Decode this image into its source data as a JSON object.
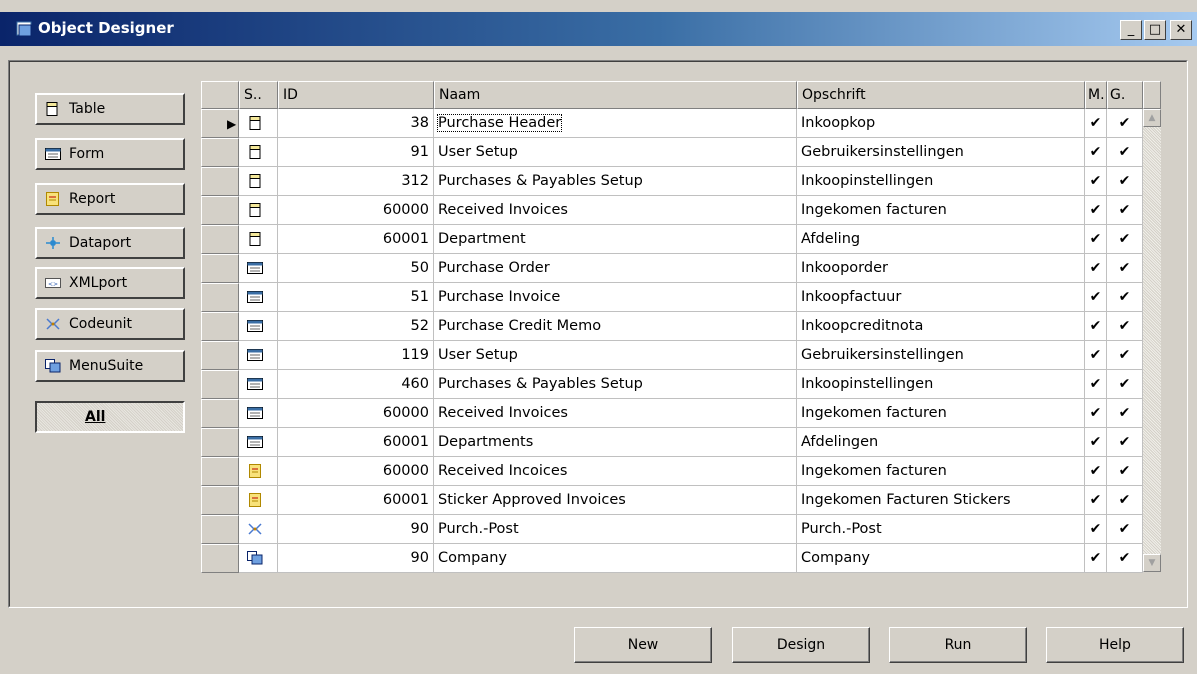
{
  "window": {
    "title": "Object Designer",
    "min_label": "_",
    "max_label": "□",
    "close_label": "✕"
  },
  "sidebar": {
    "items": [
      {
        "label": "Table",
        "icon": "table-icon"
      },
      {
        "label": "Form",
        "icon": "form-icon"
      },
      {
        "label": "Report",
        "icon": "report-icon"
      },
      {
        "label": "Dataport",
        "icon": "dataport-icon"
      },
      {
        "label": "XMLport",
        "icon": "xmlport-icon"
      },
      {
        "label": "Codeunit",
        "icon": "codeunit-icon"
      },
      {
        "label": "MenuSuite",
        "icon": "menusuite-icon"
      },
      {
        "label": "All",
        "icon": ""
      }
    ]
  },
  "grid": {
    "headers": [
      "S..",
      "ID",
      "Naam",
      "Opschrift",
      "M.",
      "G."
    ],
    "rows": [
      {
        "type": "table",
        "id": "38",
        "name": "Purchase Header",
        "caption": "Inkoopkop",
        "m": "✔",
        "g": "✔"
      },
      {
        "type": "table",
        "id": "91",
        "name": "User Setup",
        "caption": "Gebruikersinstellingen",
        "m": "✔",
        "g": "✔"
      },
      {
        "type": "table",
        "id": "312",
        "name": "Purchases & Payables Setup",
        "caption": "Inkoopinstellingen",
        "m": "✔",
        "g": "✔"
      },
      {
        "type": "table",
        "id": "60000",
        "name": "Received Invoices",
        "caption": "Ingekomen facturen",
        "m": "✔",
        "g": "✔"
      },
      {
        "type": "table",
        "id": "60001",
        "name": "Department",
        "caption": "Afdeling",
        "m": "✔",
        "g": "✔"
      },
      {
        "type": "form",
        "id": "50",
        "name": "Purchase Order",
        "caption": "Inkooporder",
        "m": "✔",
        "g": "✔"
      },
      {
        "type": "form",
        "id": "51",
        "name": "Purchase Invoice",
        "caption": "Inkoopfactuur",
        "m": "✔",
        "g": "✔"
      },
      {
        "type": "form",
        "id": "52",
        "name": "Purchase Credit Memo",
        "caption": "Inkoopcreditnota",
        "m": "✔",
        "g": "✔"
      },
      {
        "type": "form",
        "id": "119",
        "name": "User Setup",
        "caption": "Gebruikersinstellingen",
        "m": "✔",
        "g": "✔"
      },
      {
        "type": "form",
        "id": "460",
        "name": "Purchases & Payables Setup",
        "caption": "Inkoopinstellingen",
        "m": "✔",
        "g": "✔"
      },
      {
        "type": "form",
        "id": "60000",
        "name": "Received Invoices",
        "caption": "Ingekomen facturen",
        "m": "✔",
        "g": "✔"
      },
      {
        "type": "form",
        "id": "60001",
        "name": "Departments",
        "caption": "Afdelingen",
        "m": "✔",
        "g": "✔"
      },
      {
        "type": "report",
        "id": "60000",
        "name": "Received Incoices",
        "caption": "Ingekomen facturen",
        "m": "✔",
        "g": "✔"
      },
      {
        "type": "report",
        "id": "60001",
        "name": "Sticker Approved Invoices",
        "caption": "Ingekomen Facturen Stickers",
        "m": "✔",
        "g": "✔"
      },
      {
        "type": "codeunit",
        "id": "90",
        "name": "Purch.-Post",
        "caption": "Purch.-Post",
        "m": "✔",
        "g": "✔"
      },
      {
        "type": "menusuite",
        "id": "90",
        "name": "Company",
        "caption": "Company",
        "m": "✔",
        "g": "✔"
      }
    ]
  },
  "buttons": {
    "new": "New",
    "design": "Design",
    "run": "Run",
    "help": "Help"
  }
}
